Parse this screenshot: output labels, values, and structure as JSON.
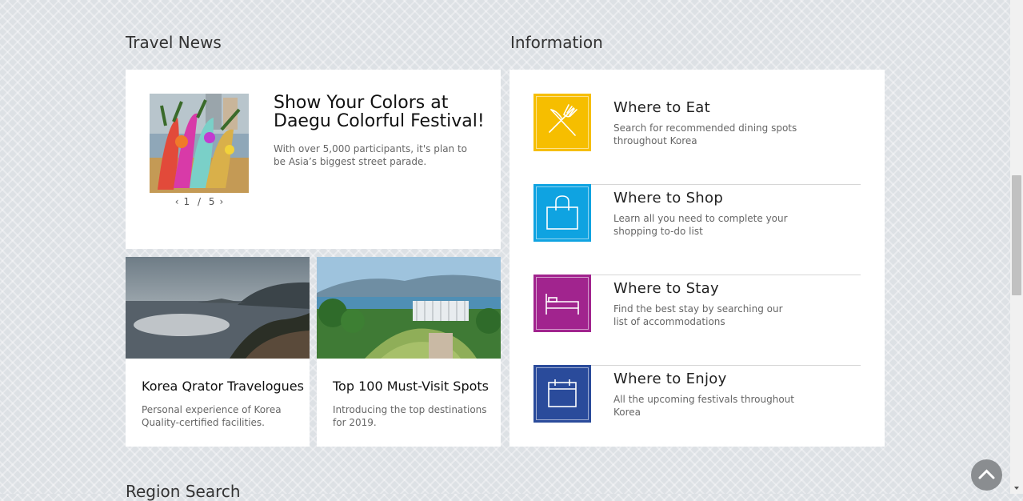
{
  "sections": {
    "travel_news_title": "Travel News",
    "information_title": "Information",
    "region_search_title": "Region Search"
  },
  "featured": {
    "title": "Show Your Colors at Daegu Colorful Festival!",
    "description": "With over 5,000 participants, it's plan to be Asia’s biggest street parade.",
    "pager": {
      "prev": "‹",
      "current": "1",
      "separator": "/",
      "total": "5",
      "next": "›"
    }
  },
  "cards": [
    {
      "title": "Korea Qrator Travelogues",
      "description": "Personal experience of Korea Quality-certified facilities."
    },
    {
      "title": "Top 100 Must-Visit Spots",
      "description": "Introducing the top destinations for 2019."
    }
  ],
  "info": [
    {
      "title": "Where to Eat",
      "description": "Search for recommended dining spots throughout Korea",
      "icon": "fork-knife-icon",
      "color": "#f6be00"
    },
    {
      "title": "Where to Shop",
      "description": "Learn all you need to complete your shopping to-do list",
      "icon": "shopping-bag-icon",
      "color": "#0fa3e1"
    },
    {
      "title": "Where to Stay",
      "description": "Find the best stay by searching our list of accommodations",
      "icon": "bed-icon",
      "color": "#a1248e"
    },
    {
      "title": "Where to Enjoy",
      "description": "All the upcoming festivals throughout Korea",
      "icon": "calendar-icon",
      "color": "#2a4b9b"
    }
  ],
  "controls": {
    "to_top_icon": "chevron-up-icon"
  }
}
